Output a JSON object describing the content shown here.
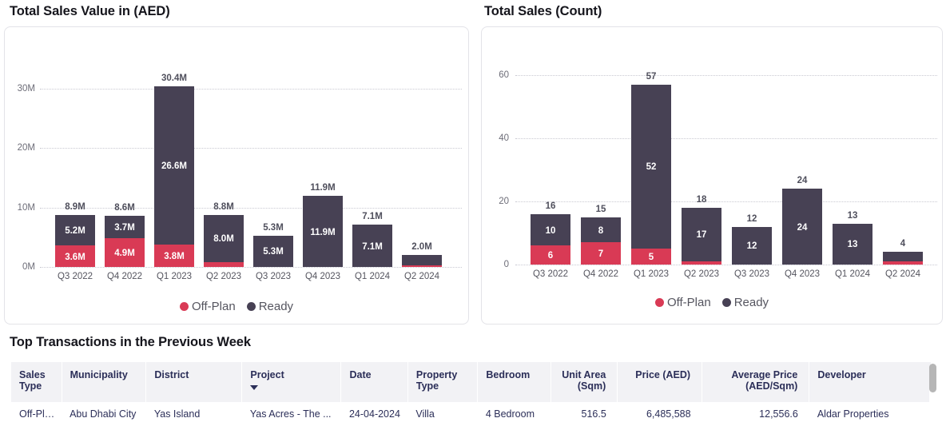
{
  "panels": {
    "left_title": "Total Sales Value in (AED)",
    "right_title": "Total Sales (Count)",
    "table_title": "Top Transactions in the Previous Week"
  },
  "colors": {
    "off_plan": "#d93a55",
    "ready": "#474154",
    "grid": "#c9c9d2",
    "header_text": "#2b2e58",
    "header_bg": "#f2f2f5"
  },
  "legend": {
    "items": [
      {
        "label": "Off-Plan",
        "color": "#d93a55"
      },
      {
        "label": "Ready",
        "color": "#474154"
      }
    ]
  },
  "chart_data": [
    {
      "type": "bar",
      "title": "Total Sales Value in (AED)",
      "stacked": true,
      "xlabel": "",
      "ylabel": "",
      "ylim": [
        0,
        34
      ],
      "yticks": [
        0,
        10,
        20,
        30
      ],
      "ytick_labels": [
        "0M",
        "10M",
        "20M",
        "30M"
      ],
      "grid": true,
      "legend_position": "bottom",
      "units": "AED millions",
      "categories": [
        "Q3 2022",
        "Q4 2022",
        "Q1 2023",
        "Q2 2023",
        "Q3 2023",
        "Q4 2023",
        "Q1 2024",
        "Q2 2024"
      ],
      "series": [
        {
          "name": "Off-Plan",
          "color": "#d93a55",
          "values": [
            3.6,
            4.9,
            3.8,
            0.8,
            0.0,
            0.0,
            0.0,
            0.25
          ],
          "labels": [
            "3.6M",
            "4.9M",
            "3.8M",
            "",
            "",
            "",
            "",
            ""
          ]
        },
        {
          "name": "Ready",
          "color": "#474154",
          "values": [
            5.2,
            3.7,
            26.6,
            8.0,
            5.3,
            11.9,
            7.1,
            1.75
          ],
          "labels": [
            "5.2M",
            "3.7M",
            "26.6M",
            "8.0M",
            "5.3M",
            "11.9M",
            "7.1M",
            ""
          ]
        }
      ],
      "totals": [
        8.9,
        8.6,
        30.4,
        8.8,
        5.3,
        11.9,
        7.1,
        2.0
      ],
      "total_labels": [
        "8.9M",
        "8.6M",
        "30.4M",
        "8.8M",
        "5.3M",
        "11.9M",
        "7.1M",
        "2.0M"
      ]
    },
    {
      "type": "bar",
      "title": "Total Sales (Count)",
      "stacked": true,
      "xlabel": "",
      "ylabel": "",
      "ylim": [
        0,
        66
      ],
      "yticks": [
        0,
        20,
        40,
        60
      ],
      "ytick_labels": [
        "0",
        "20",
        "40",
        "60"
      ],
      "grid": true,
      "legend_position": "bottom",
      "units": "count",
      "categories": [
        "Q3 2022",
        "Q4 2022",
        "Q1 2023",
        "Q2 2023",
        "Q3 2023",
        "Q4 2023",
        "Q1 2024",
        "Q2 2024"
      ],
      "series": [
        {
          "name": "Off-Plan",
          "color": "#d93a55",
          "values": [
            6,
            7,
            5,
            1,
            0,
            0,
            0,
            1
          ],
          "labels": [
            "6",
            "7",
            "5",
            "",
            "",
            "",
            "",
            ""
          ]
        },
        {
          "name": "Ready",
          "color": "#474154",
          "values": [
            10,
            8,
            52,
            17,
            12,
            24,
            13,
            3
          ],
          "labels": [
            "10",
            "8",
            "52",
            "17",
            "12",
            "24",
            "13",
            ""
          ]
        }
      ],
      "totals": [
        16,
        15,
        57,
        18,
        12,
        24,
        13,
        4
      ],
      "total_labels": [
        "16",
        "15",
        "57",
        "18",
        "12",
        "24",
        "13",
        "4"
      ]
    }
  ],
  "table": {
    "sorted_column": "Project",
    "sort_direction": "desc",
    "columns": [
      {
        "label": "Sales Type",
        "align": "left"
      },
      {
        "label": "Municipality",
        "align": "left"
      },
      {
        "label": "District",
        "align": "left"
      },
      {
        "label": "Project",
        "align": "left",
        "sort": "desc"
      },
      {
        "label": "Date",
        "align": "left"
      },
      {
        "label": "Property Type",
        "align": "left"
      },
      {
        "label": "Bedroom",
        "align": "left"
      },
      {
        "label": "Unit Area (Sqm)",
        "align": "right"
      },
      {
        "label": "Price (AED)",
        "align": "right"
      },
      {
        "label": "Average Price (AED/Sqm)",
        "align": "right"
      },
      {
        "label": "Developer",
        "align": "left"
      }
    ],
    "rows": [
      {
        "sales_type": "Off-Plan",
        "municipality": "Abu Dhabi City",
        "district": "Yas Island",
        "project": "Yas Acres - The ...",
        "date": "24-04-2024",
        "property_type": "Villa",
        "bedroom": "4 Bedroom",
        "unit_area": "516.5",
        "price": "6,485,588",
        "avg_price": "12,556.6",
        "developer": "Aldar Properties"
      }
    ]
  }
}
